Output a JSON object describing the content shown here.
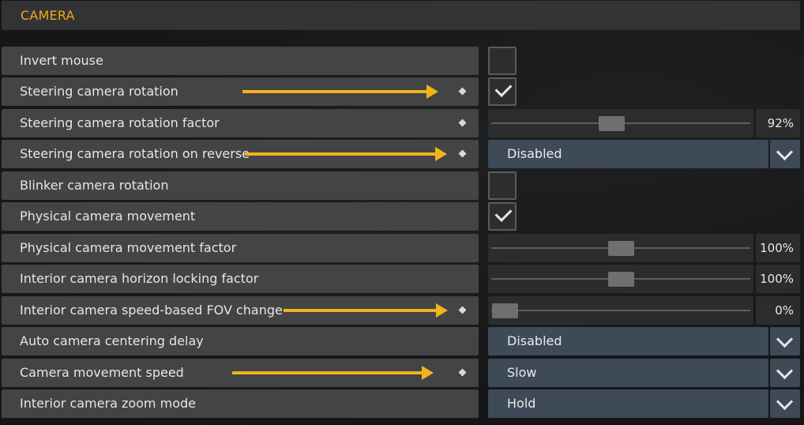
{
  "section": {
    "title": "CAMERA"
  },
  "rows": [
    {
      "label": "Invert mouse",
      "control": "checkbox",
      "checked": false,
      "modified": false,
      "arrow": false
    },
    {
      "label": "Steering camera rotation",
      "control": "checkbox",
      "checked": true,
      "modified": true,
      "arrow": true
    },
    {
      "label": "Steering camera rotation factor",
      "control": "slider",
      "value_text": "92%",
      "value": 0.92,
      "modified": true,
      "arrow": false
    },
    {
      "label": "Steering camera rotation on reverse",
      "control": "dropdown",
      "selected": "Disabled",
      "modified": true,
      "arrow": true
    },
    {
      "label": "Blinker camera rotation",
      "control": "checkbox",
      "checked": false,
      "modified": false,
      "arrow": false
    },
    {
      "label": "Physical camera movement",
      "control": "checkbox",
      "checked": true,
      "modified": false,
      "arrow": false
    },
    {
      "label": "Physical camera movement factor",
      "control": "slider",
      "value_text": "100%",
      "value": 1.0,
      "modified": false,
      "arrow": false
    },
    {
      "label": "Interior camera horizon locking factor",
      "control": "slider",
      "value_text": "100%",
      "value": 1.0,
      "modified": false,
      "arrow": false
    },
    {
      "label": "Interior camera speed-based FOV change",
      "control": "slider",
      "value_text": "0%",
      "value": 0.0,
      "modified": true,
      "arrow": true
    },
    {
      "label": "Auto camera centering delay",
      "control": "dropdown",
      "selected": "Disabled",
      "modified": false,
      "arrow": false
    },
    {
      "label": "Camera movement speed",
      "control": "dropdown",
      "selected": "Slow",
      "modified": true,
      "arrow": true
    },
    {
      "label": "Interior camera zoom mode",
      "control": "dropdown",
      "selected": "Hold",
      "modified": false,
      "arrow": false
    }
  ],
  "colors": {
    "accent": "#f0a81e",
    "arrow": "#f2b318",
    "row_bg": "#434445",
    "dropdown_bg": "#3e4a57"
  },
  "icons": {
    "checkmark": "check-icon",
    "dropdown": "chevron-down-icon",
    "modified": "diamond-icon",
    "annotation": "arrow-icon"
  }
}
